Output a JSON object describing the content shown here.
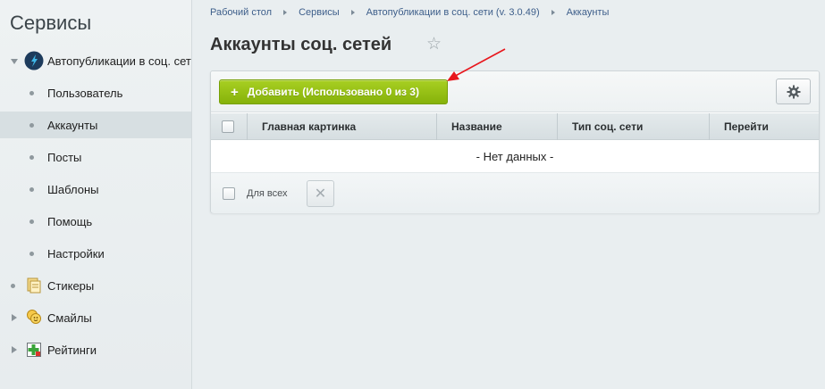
{
  "sidebar": {
    "title": "Сервисы",
    "items": [
      {
        "label": "Автопубликации в соц. сетях",
        "icon": "rocket-icon",
        "expanded": true
      },
      {
        "label": "Пользователь"
      },
      {
        "label": "Аккаунты",
        "active": true
      },
      {
        "label": "Посты"
      },
      {
        "label": "Шаблоны"
      },
      {
        "label": "Помощь"
      },
      {
        "label": "Настройки"
      },
      {
        "label": "Стикеры",
        "icon": "sticker-icon"
      },
      {
        "label": "Смайлы",
        "icon": "smile-icon"
      },
      {
        "label": "Рейтинги",
        "icon": "rating-icon"
      }
    ]
  },
  "breadcrumb": [
    "Рабочий стол",
    "Сервисы",
    "Автопубликации в соц. сети (v. 3.0.49)",
    "Аккаунты"
  ],
  "page": {
    "title": "Аккаунты соц. сетей"
  },
  "toolbar": {
    "add_label": "Добавить (Использовано 0 из 3)",
    "add_icon": "plus-icon",
    "settings_icon": "gear-icon"
  },
  "table": {
    "columns": [
      "Главная картинка",
      "Название",
      "Тип соц. сети",
      "Перейти"
    ],
    "empty_text": "- Нет данных -"
  },
  "footer": {
    "for_all_label": "Для всех",
    "delete_icon": "close-icon"
  },
  "colors": {
    "accent_green": "#8dba12",
    "link_blue": "#3d5e8a",
    "annotation_arrow": "#e8161c"
  }
}
